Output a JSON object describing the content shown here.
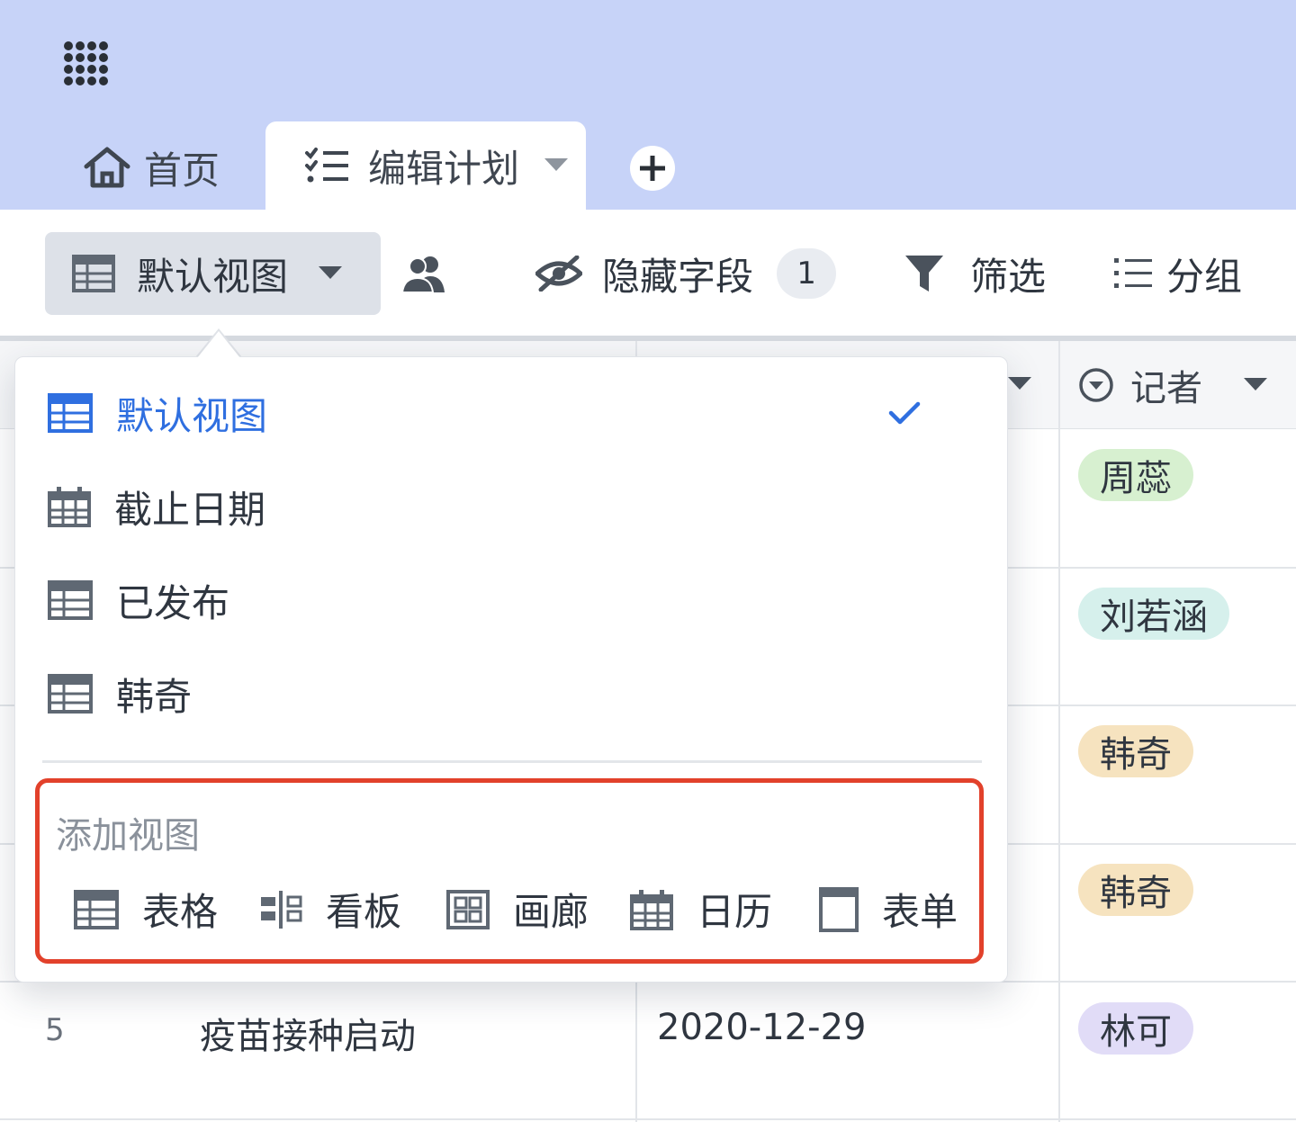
{
  "header": {
    "apps_icon": "grid-dots-icon",
    "tabs": [
      {
        "label": "首页",
        "icon": "home-icon"
      },
      {
        "label": "编辑计划",
        "icon": "checklist-icon"
      }
    ],
    "add_tab_icon": "plus-icon"
  },
  "toolbar": {
    "view_switcher_label": "默认视图",
    "hide_fields_label": "隐藏字段",
    "hide_fields_count": "1",
    "filter_label": "筛选",
    "group_label": "分组"
  },
  "table": {
    "visible_column_header": "记者",
    "row_5": {
      "number": "5",
      "title": "疫苗接种启动",
      "date": "2020-12-29"
    },
    "reporter_tags": [
      {
        "name": "周蕊",
        "color": "#d7f0d0"
      },
      {
        "name": "刘若涵",
        "color": "#d6f0ec"
      },
      {
        "name": "韩奇",
        "color": "#f6e3bf"
      },
      {
        "name": "韩奇",
        "color": "#f6e3bf"
      },
      {
        "name": "林可",
        "color": "#e1dcf7"
      }
    ]
  },
  "view_menu": {
    "views": [
      {
        "label": "默认视图",
        "icon": "table-icon",
        "selected": true
      },
      {
        "label": "截止日期",
        "icon": "calendar-icon",
        "selected": false
      },
      {
        "label": "已发布",
        "icon": "table-icon",
        "selected": false
      },
      {
        "label": "韩奇",
        "icon": "table-icon",
        "selected": false
      }
    ],
    "add_view": {
      "title": "添加视图",
      "types": [
        {
          "label": "表格",
          "icon": "table-icon"
        },
        {
          "label": "看板",
          "icon": "kanban-icon"
        },
        {
          "label": "画廊",
          "icon": "gallery-icon"
        },
        {
          "label": "日历",
          "icon": "calendar-icon"
        },
        {
          "label": "表单",
          "icon": "form-icon"
        }
      ]
    }
  },
  "colors": {
    "header_bg": "#c7d3f8",
    "accent_blue": "#2f6fe0",
    "highlight_red": "#e2412b"
  }
}
